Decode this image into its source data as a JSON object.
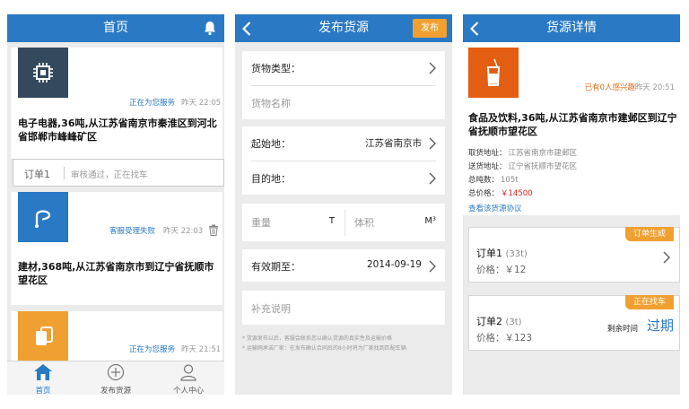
{
  "home": {
    "title": "首页",
    "cards": [
      {
        "status": "正在为您服务",
        "time": "昨天 22:05",
        "title": "电子电器,36吨,从江苏省南京市秦淮区到河北省邯郸市峰峰矿区",
        "thumb_color": "#34495e",
        "icon": "chip-icon"
      },
      {
        "status": "客服受理失败",
        "time": "昨天 22:03",
        "title": "建材,368吨,从江苏省南京市到辽宁省抚顺市望花区",
        "thumb_color": "#2a79c5",
        "icon": "hook-icon"
      },
      {
        "status": "正在为您服务",
        "time": "昨天 21:51",
        "title": "",
        "thumb_color": "#f0a030",
        "icon": "copy-icon"
      }
    ],
    "order": {
      "label": "订单1",
      "text": "审核通过，正在找车"
    },
    "tabs": [
      {
        "label": "首页",
        "icon": "home-icon"
      },
      {
        "label": "发布货源",
        "icon": "add-icon"
      },
      {
        "label": "个人中心",
        "icon": "user-icon"
      }
    ]
  },
  "publish": {
    "title": "发布货源",
    "publish_label": "发布",
    "cargo_type_label": "货物类型：",
    "cargo_name_placeholder": "货物名称",
    "origin_label": "起始地：",
    "origin_value": "江苏省南京市",
    "destination_label": "目的地：",
    "weight_placeholder": "重量",
    "weight_unit": "T",
    "volume_placeholder": "体积",
    "volume_unit": "M³",
    "valid_until_label": "有效期至：",
    "valid_until_value": "2014-09-19",
    "remarks_placeholder": "补充说明",
    "note1": "* 货源发布以后，客服会联系您以确认货源的真实性及运输价格",
    "note2": "* 运输网承诺厂家：在发布确认合同后的8小时将为厂家找到匹配车辆"
  },
  "detail": {
    "title": "货源详情",
    "interest": "已有0人感兴趣",
    "time": "昨天 20:51",
    "cargo_title": "食品及饮料,36吨,从江苏省南京市建邺区到辽宁省抚顺市望花区",
    "pickup_label": "取货地址：",
    "pickup_value": "江苏省南京市建邺区",
    "delivery_label": "送货地址：",
    "delivery_value": "辽宁省抚顺市望花区",
    "tonnage_label": "总吨数：",
    "tonnage_value": "105t",
    "total_price_label": "总价格：",
    "total_price_value": "￥14500",
    "agreement_link": "查看该货源协议",
    "orders": [
      {
        "badge": "订单生成",
        "name": "订单1",
        "tons": "(33t)",
        "price": "价格：￥12"
      },
      {
        "badge": "正在找车",
        "name": "订单2",
        "tons": "(3t)",
        "price": "价格：￥123",
        "remaining_label": "剩余时间",
        "remaining_value": "过期"
      }
    ]
  },
  "colors": {
    "primary": "#2a79c5",
    "accent": "#f0a030",
    "danger": "#e02020",
    "food_thumb": "#e35d12"
  }
}
